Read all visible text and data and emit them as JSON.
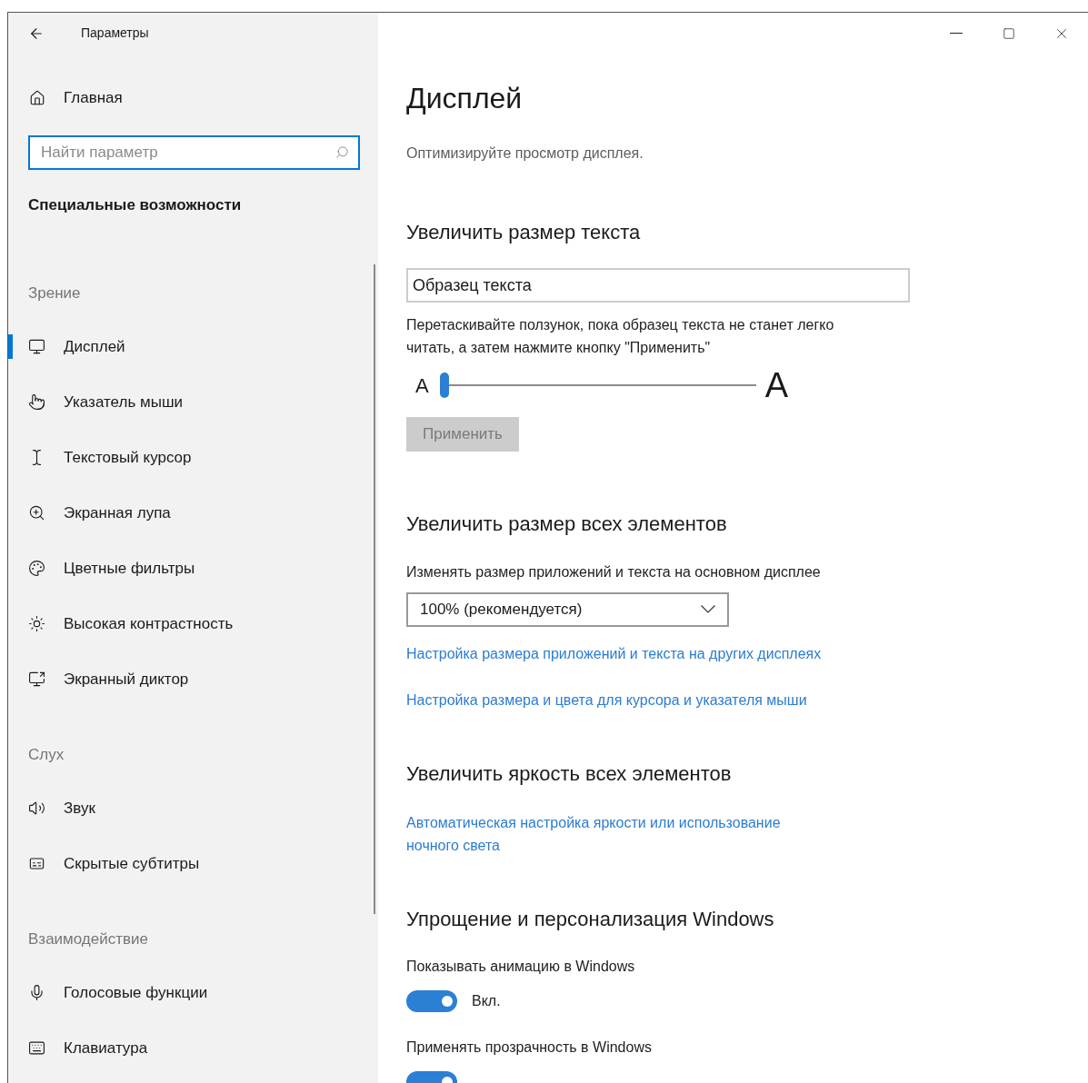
{
  "window": {
    "title": "Параметры"
  },
  "sidebar": {
    "home": "Главная",
    "search": {
      "placeholder": "Найти параметр"
    },
    "category": "Специальные возможности",
    "groups": [
      {
        "title": "Зрение",
        "items": [
          {
            "label": "Дисплей",
            "selected": true
          },
          {
            "label": "Указатель мыши",
            "selected": false
          },
          {
            "label": "Текстовый курсор",
            "selected": false
          },
          {
            "label": "Экранная лупа",
            "selected": false
          },
          {
            "label": "Цветные фильтры",
            "selected": false
          },
          {
            "label": "Высокая контрастность",
            "selected": false
          },
          {
            "label": "Экранный диктор",
            "selected": false
          }
        ]
      },
      {
        "title": "Слух",
        "items": [
          {
            "label": "Звук",
            "selected": false
          },
          {
            "label": "Скрытые субтитры",
            "selected": false
          }
        ]
      },
      {
        "title": "Взаимодействие",
        "items": [
          {
            "label": "Голосовые функции",
            "selected": false
          },
          {
            "label": "Клавиатура",
            "selected": false
          }
        ]
      }
    ]
  },
  "main": {
    "title": "Дисплей",
    "subtitle": "Оптимизируйте просмотр дисплея.",
    "text_size": {
      "heading": "Увеличить размер текста",
      "sample": "Образец текста",
      "description": "Перетаскивайте ползунок, пока образец текста не станет легко читать, а затем нажмите кнопку \"Применить\"",
      "slider": {
        "small_label": "A",
        "large_label": "A",
        "level": 0
      },
      "apply_button": {
        "label": "Применить",
        "disabled": true
      }
    },
    "scaling": {
      "heading": "Увеличить размер всех элементов",
      "label": "Изменять размер приложений и текста на основном дисплее",
      "dropdown": {
        "value": "100% (рекомендуется)"
      },
      "links": [
        "Настройка размера приложений и текста на других дисплеях",
        "Настройка размера и цвета для курсора и указателя мыши"
      ]
    },
    "brightness": {
      "heading": "Увеличить яркость всех элементов",
      "link": "Автоматическая настройка яркости или использование ночного света"
    },
    "simplify": {
      "heading": "Упрощение и персонализация Windows",
      "toggles": [
        {
          "label": "Показывать анимацию в Windows",
          "on": true,
          "state_label": "Вкл."
        },
        {
          "label": "Применять прозрачность в Windows",
          "on": true
        }
      ]
    }
  }
}
